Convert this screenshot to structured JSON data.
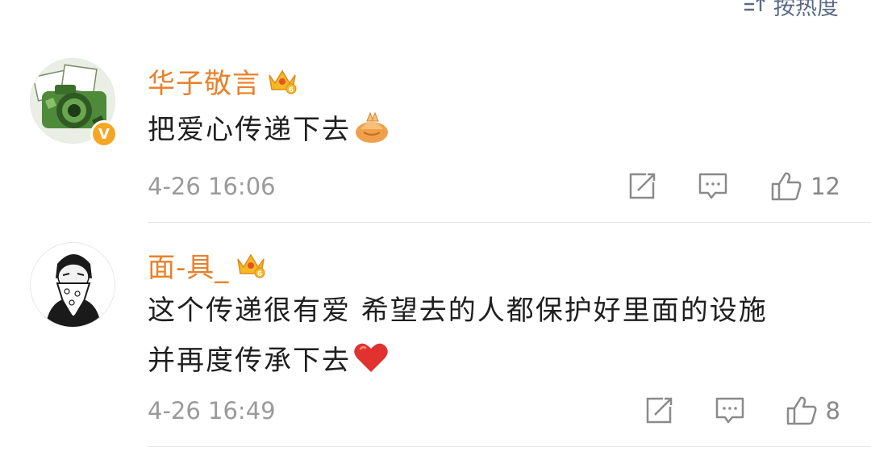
{
  "sort": {
    "label": "按热度"
  },
  "comments": [
    {
      "username": "华子敬言",
      "text_line1": "把爱心传递下去",
      "text_line2": "",
      "emoji": "clasped-hands-emoji",
      "time": "4-26 16:06",
      "likes": "12",
      "verified": true
    },
    {
      "username": "面-具_",
      "text_line1": "这个传递很有爱 希望去的人都保护好里面的设施",
      "text_line2": "并再度传承下去",
      "emoji": "red-heart-emoji",
      "time": "4-26 16:49",
      "likes": "8",
      "verified": false
    }
  ],
  "colors": {
    "username": "#e8812b",
    "text": "#1f1f1f",
    "meta": "#9a9a9a",
    "icon": "#8a8a8a",
    "sort": "#5b6a84",
    "badge": "#f6a623"
  }
}
